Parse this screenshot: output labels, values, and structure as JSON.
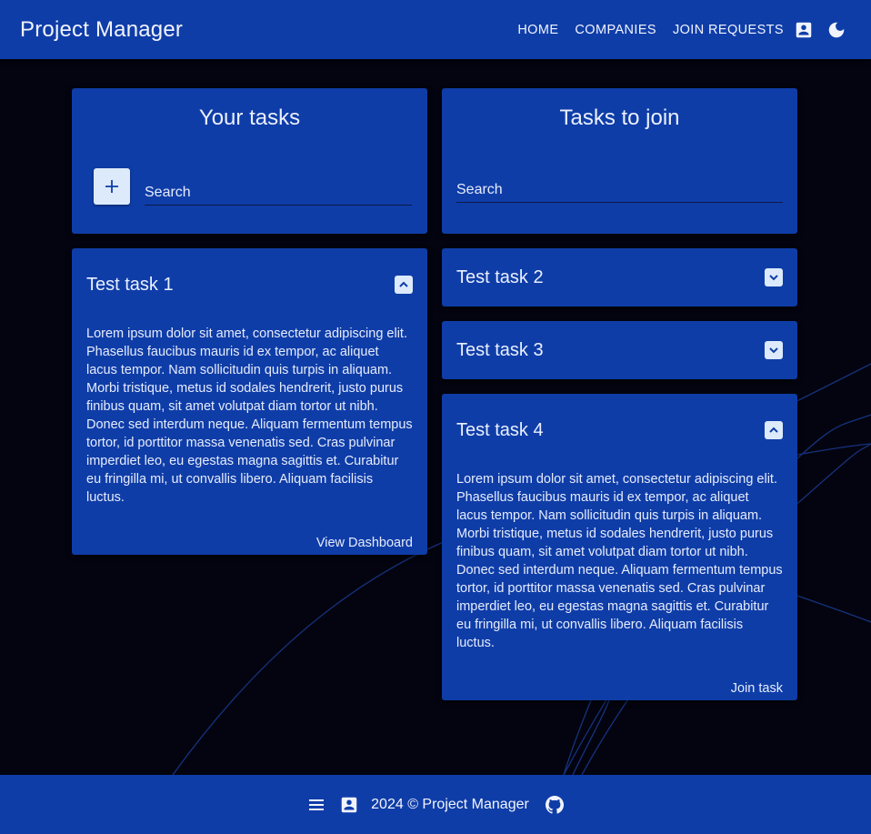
{
  "app": {
    "brand": "Project Manager",
    "nav": [
      "HOME",
      "COMPANIES",
      "JOIN REQUESTS"
    ]
  },
  "your_tasks": {
    "title": "Your tasks",
    "search_placeholder": "Search",
    "tasks": [
      {
        "title": "Test task 1",
        "expanded": true,
        "description": "Lorem ipsum dolor sit amet, consectetur adipiscing elit. Phasellus faucibus mauris id ex tempor, ac aliquet lacus tempor. Nam sollicitudin quis turpis in aliquam. Morbi tristique, metus id sodales hendrerit, justo purus finibus quam, sit amet volutpat diam tortor ut nibh. Donec sed interdum neque. Aliquam fermentum tempus tortor, id porttitor massa venenatis sed. Cras pulvinar imperdiet leo, eu egestas magna sagittis et. Curabitur eu fringilla mi, ut convallis libero. Aliquam facilisis luctus.",
        "action": "View Dashboard"
      }
    ]
  },
  "tasks_to_join": {
    "title": "Tasks to join",
    "search_placeholder": "Search",
    "tasks": [
      {
        "title": "Test task 2",
        "expanded": false
      },
      {
        "title": "Test task 3",
        "expanded": false
      },
      {
        "title": "Test task 4",
        "expanded": true,
        "description": "Lorem ipsum dolor sit amet, consectetur adipiscing elit. Phasellus faucibus mauris id ex tempor, ac aliquet lacus tempor. Nam sollicitudin quis turpis in aliquam. Morbi tristique, metus id sodales hendrerit, justo purus finibus quam, sit amet volutpat diam tortor ut nibh. Donec sed interdum neque. Aliquam fermentum tempus tortor, id porttitor massa venenatis sed. Cras pulvinar imperdiet leo, eu egestas magna sagittis et. Curabitur eu fringilla mi, ut convallis libero. Aliquam facilisis luctus.",
        "action": "Join task"
      }
    ]
  },
  "footer": {
    "text": "2024 © Project Manager"
  },
  "icons": {
    "profile": "account-box-icon",
    "theme": "moon-icon",
    "add": "plus-icon",
    "collapse": "chevron-up-icon",
    "expand": "chevron-down-icon",
    "menu": "menu-icon",
    "github": "github-icon"
  },
  "colors": {
    "primary": "#0f3da8",
    "background": "#03040f",
    "accent_light": "#dceafb",
    "text": "#e6ecfb"
  }
}
